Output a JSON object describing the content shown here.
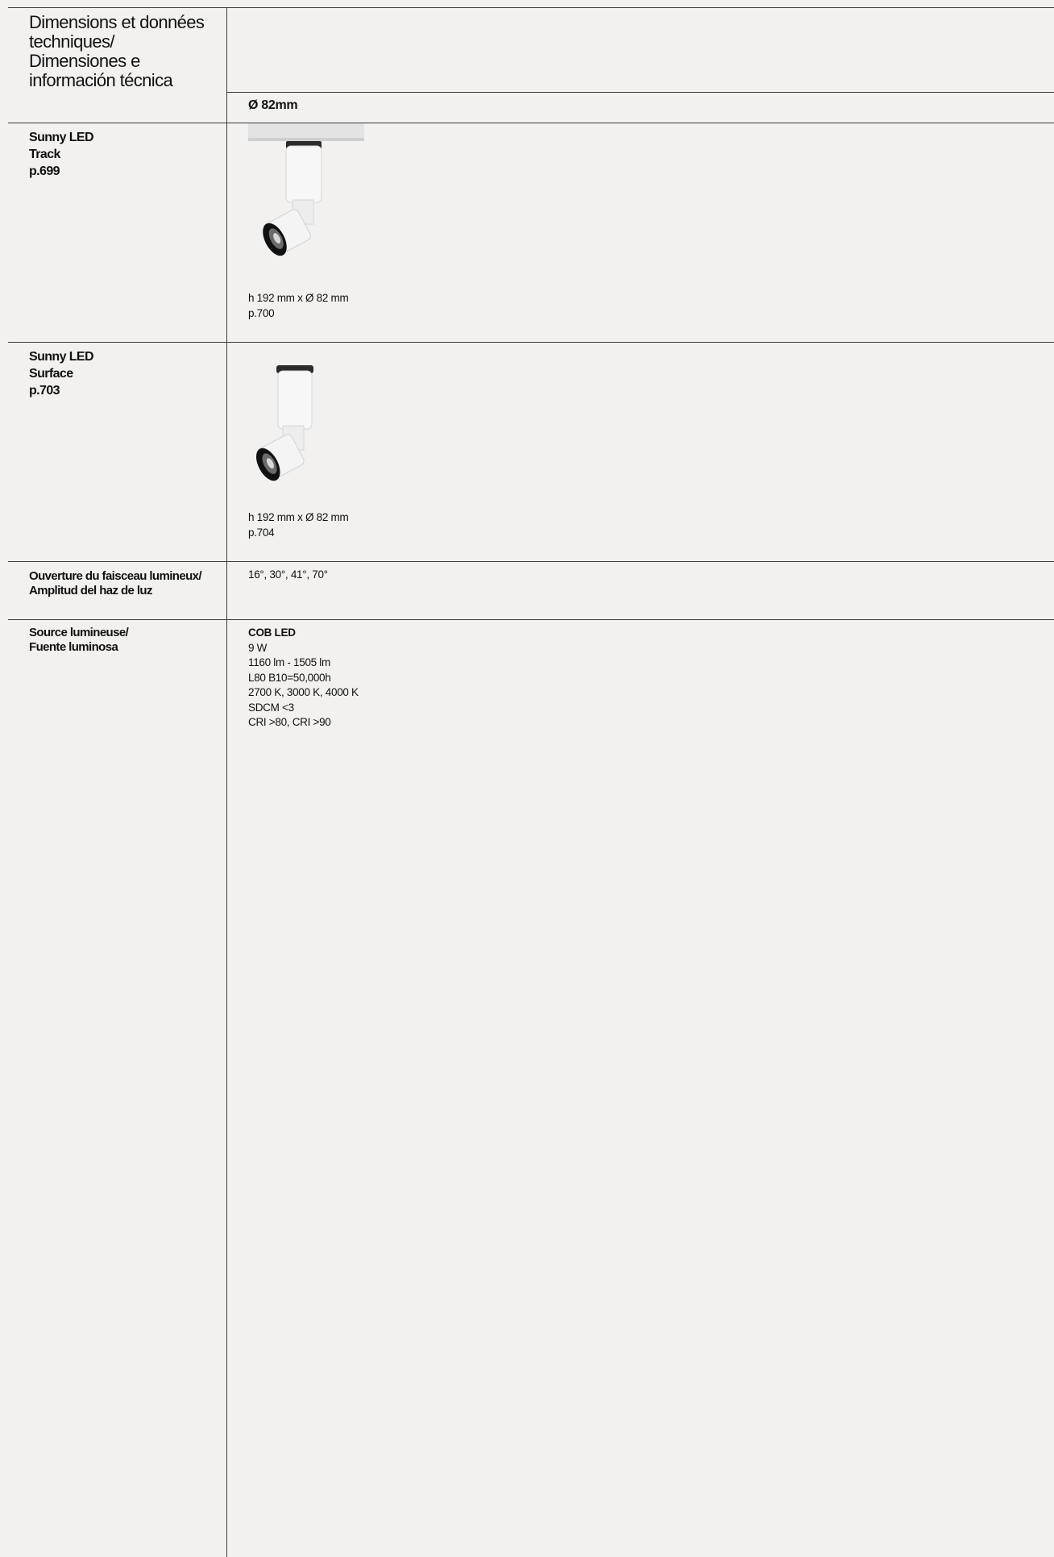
{
  "header": {
    "title_lines": [
      "Dimensions et données",
      "techniques/",
      "Dimensiones e",
      "información técnica"
    ],
    "column_label": "Ø 82mm"
  },
  "rows": {
    "track": {
      "label_lines": [
        "Sunny LED",
        "Track",
        "p.699"
      ],
      "dimensions": "h 192 mm x Ø 82 mm",
      "page": "p.700"
    },
    "surface": {
      "label_lines": [
        "Sunny LED",
        "Surface",
        "p.703"
      ],
      "dimensions": "h 192 mm x Ø 82 mm",
      "page": "p.704"
    },
    "beam": {
      "label_lines": [
        "Ouverture du faisceau lumineux/",
        "Amplitud del haz de luz"
      ],
      "value": "16°, 30°, 41°, 70°"
    },
    "source": {
      "label_lines": [
        "Source lumineuse/",
        "Fuente luminosa"
      ],
      "lines": [
        "COB LED",
        "9 W",
        "1160 lm - 1505 lm",
        "L80 B10=50,000h",
        "2700 K, 3000 K, 4000 K",
        "SDCM <3",
        "CRI >80, CRI >90"
      ]
    }
  },
  "icons": {
    "track_image": "track-spotlight-icon",
    "surface_image": "surface-spotlight-icon"
  }
}
